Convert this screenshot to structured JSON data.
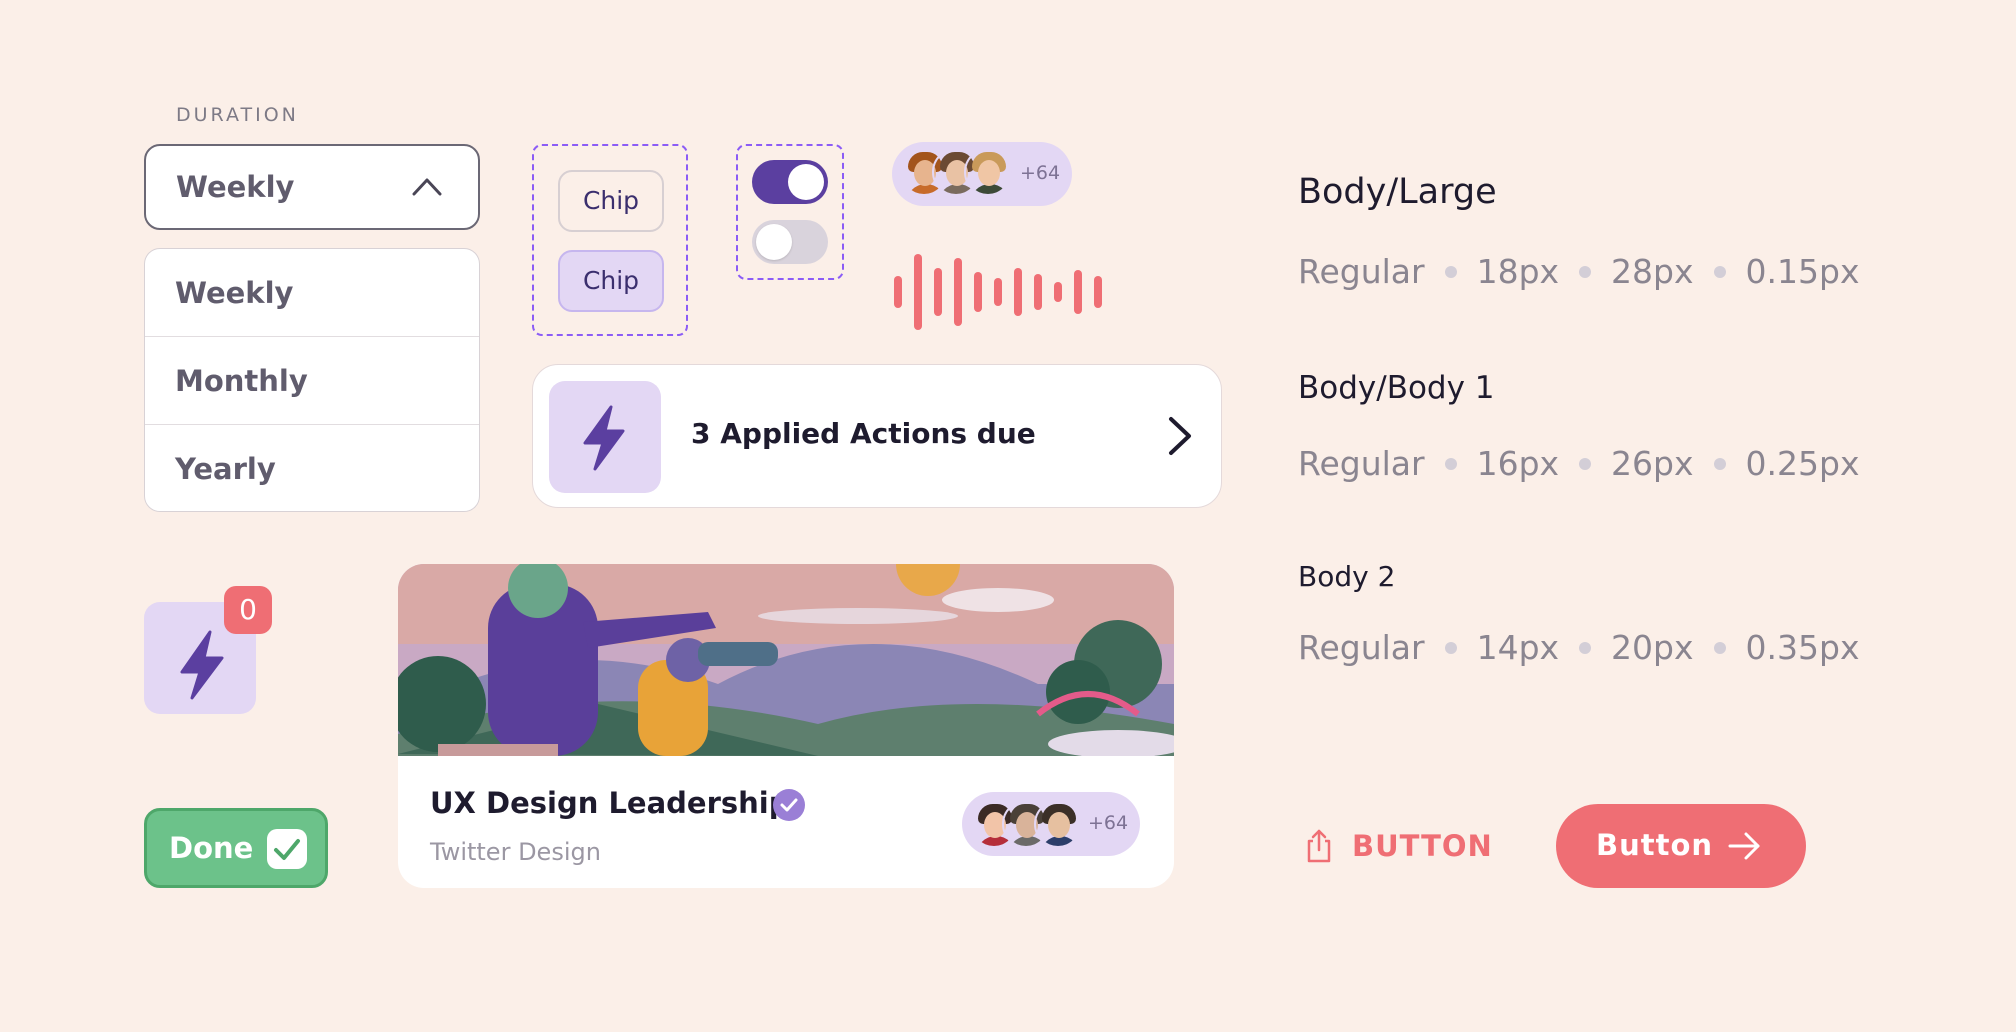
{
  "dropdown": {
    "label": "DURATION",
    "selected": "Weekly",
    "options": [
      "Weekly",
      "Monthly",
      "Yearly"
    ]
  },
  "chips": [
    "Chip",
    "Chip"
  ],
  "toggles": [
    {
      "state": "on"
    },
    {
      "state": "off"
    }
  ],
  "avatar_group_top": {
    "count": "+64"
  },
  "actions_card": {
    "text": "3 Applied Actions due"
  },
  "notification_badge": {
    "count": "0"
  },
  "done_button": {
    "label": "Done"
  },
  "course_card": {
    "title": "UX Design Leadership",
    "subtitle": "Twitter Design",
    "members_count": "+64"
  },
  "typography": [
    {
      "name": "Body/Large",
      "weight": "Regular",
      "size": "18px",
      "line_height": "28px",
      "letter_spacing": "0.15px"
    },
    {
      "name": "Body/Body 1",
      "weight": "Regular",
      "size": "16px",
      "line_height": "26px",
      "letter_spacing": "0.25px"
    },
    {
      "name": "Body 2",
      "weight": "Regular",
      "size": "14px",
      "line_height": "20px",
      "letter_spacing": "0.35px"
    }
  ],
  "buttons": {
    "text_button": "BUTTON",
    "primary_button": "Button"
  },
  "colors": {
    "background": "#fbefe8",
    "primary": "#5b3fa0",
    "accent_light": "#e3d7f4",
    "coral": "#ef6e74",
    "success": "#6cc28a"
  },
  "icons": [
    "chevron-up-icon",
    "bolt-icon",
    "chevron-right-icon",
    "check-icon",
    "verified-icon",
    "share-icon",
    "arrow-right-icon",
    "waveform-icon"
  ]
}
